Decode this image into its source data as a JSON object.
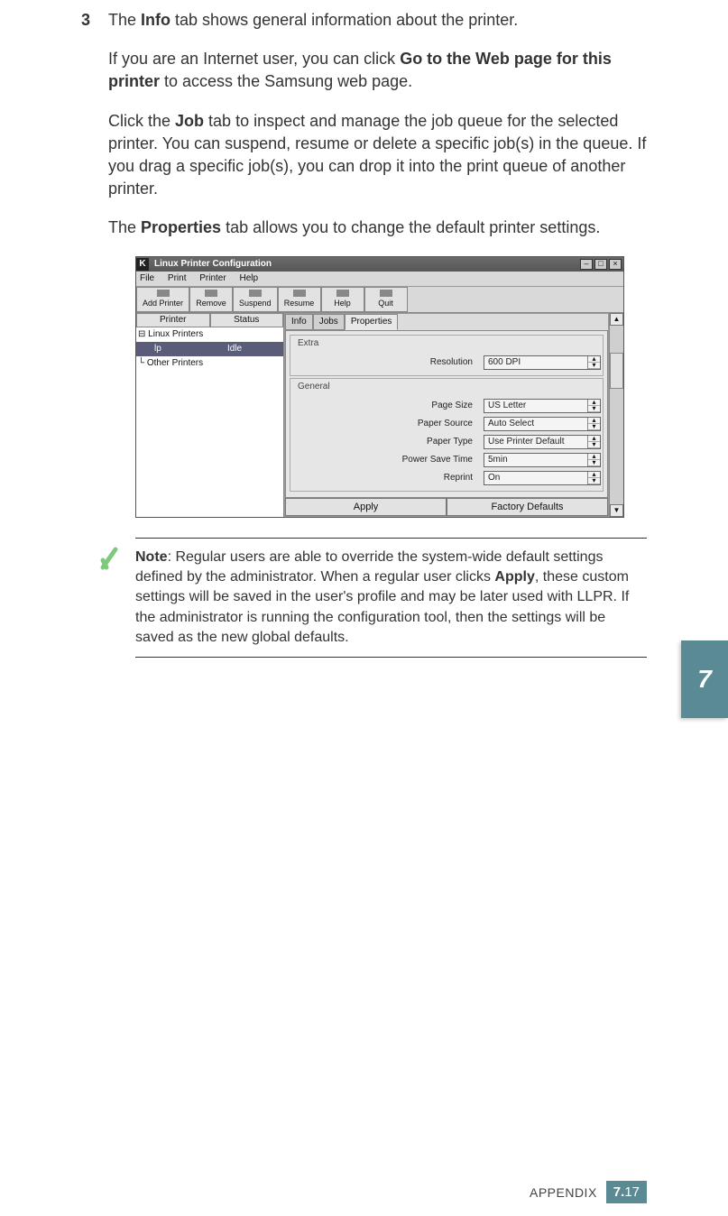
{
  "step": {
    "number": "3",
    "para1_a": "The ",
    "para1_b": "Info",
    "para1_c": " tab shows general information about the printer.",
    "para2_a": "If you are an Internet user, you can click ",
    "para2_b": "Go to the Web page for this printer",
    "para2_c": " to access the Samsung web page.",
    "para3_a": "Click the ",
    "para3_b": "Job",
    "para3_c": " tab to inspect and manage the job queue for the selected printer. You can suspend, resume or delete a specific job(s) in the queue. If you drag a specific job(s), you can drop it into the print queue of another printer.",
    "para4_a": "The ",
    "para4_b": "Properties",
    "para4_c": " tab allows you to change the default printer settings."
  },
  "window": {
    "k": "K",
    "title": "Linux Printer Configuration",
    "menu": {
      "file": "File",
      "print": "Print",
      "printer": "Printer",
      "help": "Help"
    },
    "toolbar": {
      "add": "Add Printer",
      "remove": "Remove",
      "suspend": "Suspend",
      "resume": "Resume",
      "help": "Help",
      "quit": "Quit"
    },
    "columns": {
      "printer": "Printer",
      "status": "Status"
    },
    "tree": {
      "root": "Linux Printers",
      "item_name": "lp",
      "item_status": "Idle",
      "other": "Other Printers"
    },
    "tabs": {
      "info": "Info",
      "jobs": "Jobs",
      "properties": "Properties"
    },
    "groups": {
      "extra": "Extra",
      "general": "General"
    },
    "props": {
      "resolution": {
        "label": "Resolution",
        "value": "600 DPI"
      },
      "page_size": {
        "label": "Page Size",
        "value": "US Letter"
      },
      "paper_source": {
        "label": "Paper Source",
        "value": "Auto Select"
      },
      "paper_type": {
        "label": "Paper Type",
        "value": "Use Printer Default"
      },
      "power_save": {
        "label": "Power Save Time",
        "value": "5min"
      },
      "reprint": {
        "label": "Reprint",
        "value": "On"
      }
    },
    "buttons": {
      "apply": "Apply",
      "defaults": "Factory Defaults"
    },
    "winbtn": {
      "min": "–",
      "max": "□",
      "close": "×"
    },
    "scroll": {
      "up": "▲",
      "down": "▼"
    }
  },
  "note": {
    "label": "Note",
    "sep": ": ",
    "body_a": "Regular users are able to override the system-wide default settings defined by the administrator. When a regular user clicks ",
    "body_b": "Apply",
    "body_c": ", these custom settings will be saved in the user's profile and may be later used with LLPR. If the administrator is running the configuration tool, then the settings will be saved as the new global defaults."
  },
  "side": {
    "chapter": "7"
  },
  "footer": {
    "appendix": "APPENDIX",
    "chapter": "7.",
    "page": "17"
  }
}
